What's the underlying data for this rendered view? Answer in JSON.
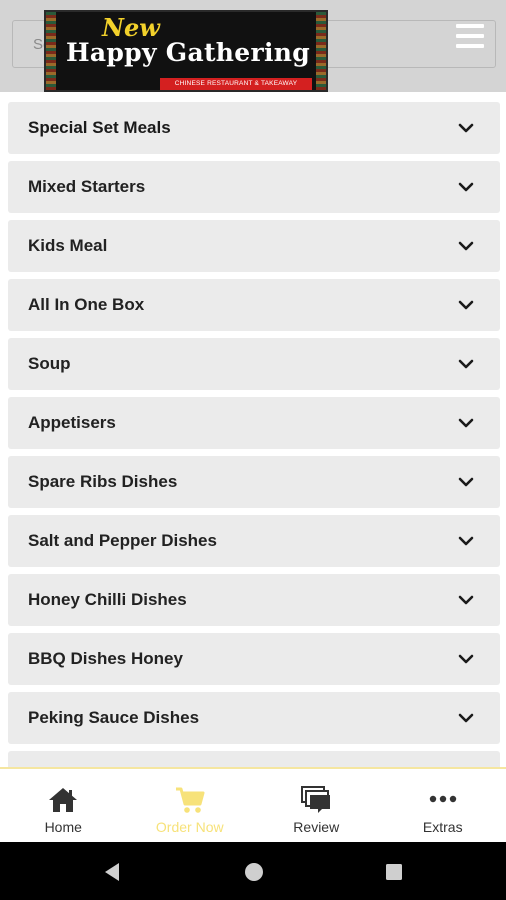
{
  "header": {
    "search_placeholder": "Search",
    "logo": {
      "line1": "New",
      "line2": "Happy Gathering",
      "tagline": "CHINESE RESTAURANT & TAKEAWAY"
    }
  },
  "categories": [
    {
      "label": "Special Set Meals"
    },
    {
      "label": "Mixed Starters"
    },
    {
      "label": "Kids Meal"
    },
    {
      "label": "All In One Box"
    },
    {
      "label": "Soup"
    },
    {
      "label": "Appetisers"
    },
    {
      "label": "Spare Ribs Dishes"
    },
    {
      "label": "Salt and Pepper Dishes"
    },
    {
      "label": "Honey Chilli Dishes"
    },
    {
      "label": "BBQ Dishes Honey"
    },
    {
      "label": "Peking Sauce Dishes"
    }
  ],
  "bottom_nav": {
    "items": [
      {
        "label": "Home",
        "icon": "home-icon"
      },
      {
        "label": "Order Now",
        "icon": "cart-icon",
        "active": true
      },
      {
        "label": "Review",
        "icon": "review-icon"
      },
      {
        "label": "Extras",
        "icon": "more-icon"
      }
    ]
  },
  "colors": {
    "header_bg": "#d4d4d4",
    "item_bg": "#ebebeb",
    "accent_active": "#f7e27a",
    "logo_red": "#d42020",
    "logo_yellow": "#f2d12b"
  }
}
